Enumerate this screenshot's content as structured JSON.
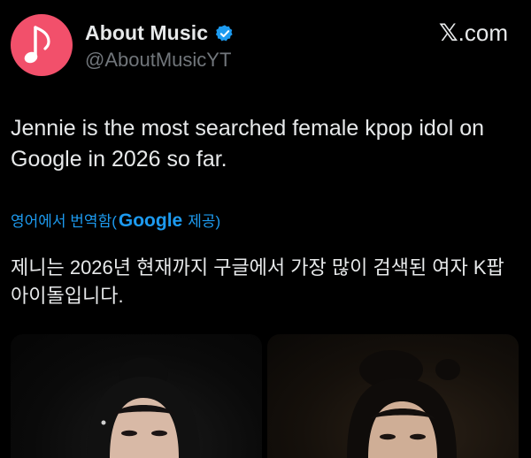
{
  "author": {
    "display_name": "About Music",
    "handle": "@AboutMusicYT",
    "avatar_icon": "music-note-icon",
    "verified_icon": "verified-badge-icon",
    "avatar_color": "#f2506b",
    "verified_color": "#1d9bf0"
  },
  "site": {
    "x_mark": "𝕏",
    "domain": ".com"
  },
  "tweet": {
    "text": "Jennie is the most searched female kpop idol on Google in 2026 so far."
  },
  "translation": {
    "prefix": "영어에서 번역함(",
    "provider": "Google",
    "suffix": "제공)",
    "text": "제니는 2026년 현재까지 구글에서 가장 많이 검색된 여자 K팝 아이돌입니다."
  },
  "media": {
    "count": 2
  },
  "colors": {
    "background": "#000000",
    "text": "#e7e9ea",
    "secondary": "#71767b",
    "link": "#1d9bf0"
  }
}
